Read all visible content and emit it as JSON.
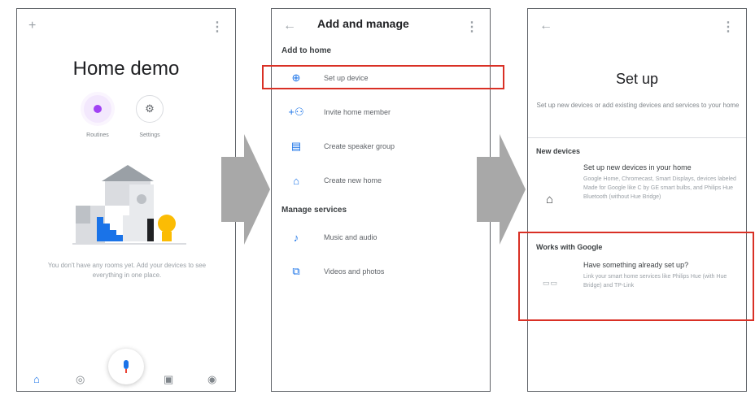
{
  "screen1": {
    "title": "Home demo",
    "routines_label": "Routines",
    "settings_label": "Settings",
    "empty_text": "You don't have any rooms yet. Add your devices to see everything in one place.",
    "colors": {
      "accent": "#a142f4",
      "blue": "#1a73e8",
      "yellow": "#fbbc04"
    }
  },
  "screen2": {
    "title": "Add and manage",
    "section_add": "Add to home",
    "section_manage": "Manage services",
    "add_items": [
      {
        "label": "Set up device",
        "icon": "plus-circle-icon"
      },
      {
        "label": "Invite home member",
        "icon": "add-person-icon"
      },
      {
        "label": "Create speaker group",
        "icon": "speaker-group-icon"
      },
      {
        "label": "Create new home",
        "icon": "home-icon"
      }
    ],
    "manage_items": [
      {
        "label": "Music and audio",
        "icon": "music-note-icon"
      },
      {
        "label": "Videos and photos",
        "icon": "video-icon"
      }
    ]
  },
  "screen3": {
    "title": "Set up",
    "subtitle": "Set up new devices or add existing devices and services to your home",
    "section_new": "New devices",
    "new_heading": "Set up new devices in your home",
    "new_desc": "Google Home, Chromecast, Smart Displays, devices labeled Made for Google like C by GE smart bulbs, and Philips Hue Bluetooth (without Hue Bridge)",
    "section_works": "Works with Google",
    "works_heading": "Have something already set up?",
    "works_desc": "Link your smart home services like Philips Hue (with Hue Bridge) and TP-Link"
  },
  "highlight_color": "#d93025"
}
